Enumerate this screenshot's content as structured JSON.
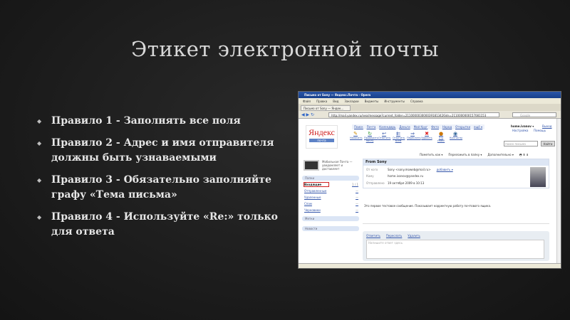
{
  "slide": {
    "title": "Этикет электронной почты",
    "bullets": [
      "Правило 1 - Заполнять все поля",
      "Правило 2 - Адрес и имя отправителя должны быть узнаваемыми",
      "Правило 3 - Обязательно заполняйте графу «Тема письма»",
      "Правило 4 - Используйте «Re:» только для ответа"
    ]
  },
  "browser": {
    "window_title": "Письмо от Sony — Яндекс.Почта - Opera",
    "menu": [
      "Файл",
      "Правка",
      "Вид",
      "Закладки",
      "Виджеты",
      "Инструменты",
      "Справка"
    ],
    "tab": "Письмо от Sony — Яндек...",
    "url": "http://mail.yandex.ru/neo/message?current_folder=2110000030000391813426ids=2110000000157081153",
    "search_placeholder": "Google"
  },
  "mail": {
    "logo": "Яндекс",
    "logo_sub": "почта",
    "nav": [
      "Поиск",
      "Почта",
      "Календарь",
      "Деньги",
      "Мой Круг",
      "Фото",
      "Народ",
      "Открытки",
      "ещё ▾"
    ],
    "tools": [
      "Написать",
      "Проверить почту",
      "Ответить",
      "Ответить всем",
      "Переслать",
      "Удалить",
      "Это спам!",
      "Контакты"
    ],
    "user": "home.ivanov ▾",
    "logout": "Выход",
    "settings": "Настройка",
    "help": "Помощь",
    "search_placeholder": "поиск письма",
    "search_button": "Найти",
    "actions": [
      "Пометить как ▾",
      "Переложить в папку ▾",
      "Дополнительно ▾"
    ],
    "promo": "Мобильная Почта — уведомляет и доставляет",
    "folders_header": "Папки",
    "folders": [
      {
        "name": "Входящие",
        "count": "1 / 1"
      },
      {
        "name": "Отправленные",
        "count": "—"
      },
      {
        "name": "Удаленные",
        "count": "—"
      },
      {
        "name": "Спам",
        "count": "—"
      },
      {
        "name": "Черновики",
        "count": "—"
      }
    ],
    "labels_header": "Метки",
    "news_header": "Новости",
    "subject": "From Sony",
    "from_label": "От кого",
    "from_value": "Sony <sony.mowеb@mail.ru>",
    "add_link": "добавить ▾",
    "to_label": "Кому",
    "to_value": "home.ivanov@yandex.ru",
    "sent_label": "Отправлено",
    "sent_value": "19 октября 2009 в 10:13",
    "body": "Это первое тестовое сообщение. Показывает корректную работу почтового ящика.",
    "reply_actions": [
      "Ответить",
      "Переслать",
      "Удалить"
    ],
    "reply_placeholder": "Напишите ответ здесь"
  }
}
